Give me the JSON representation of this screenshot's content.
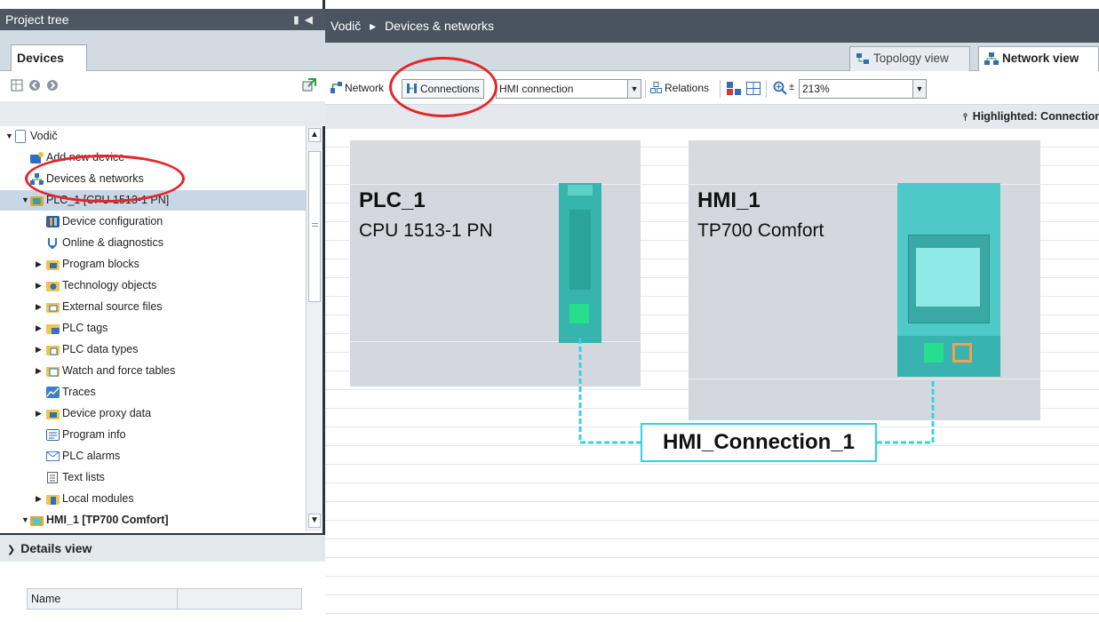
{
  "project_tree": {
    "title": "Project tree",
    "tab": "Devices",
    "items": [
      {
        "label": "Vodič",
        "level": 0,
        "expanded": true,
        "icon": "project-icon"
      },
      {
        "label": "Add new device",
        "level": 1,
        "icon": "add-device-icon"
      },
      {
        "label": "Devices & networks",
        "level": 1,
        "icon": "network-icon"
      },
      {
        "label": "PLC_1 [CPU 1513-1 PN]",
        "level": 1,
        "expanded": true,
        "icon": "plc-icon"
      },
      {
        "label": "Device configuration",
        "level": 2,
        "icon": "device-config-icon"
      },
      {
        "label": "Online & diagnostics",
        "level": 2,
        "icon": "diagnostics-icon"
      },
      {
        "label": "Program blocks",
        "level": 2,
        "collapsed": true,
        "icon": "folder-icon"
      },
      {
        "label": "Technology objects",
        "level": 2,
        "collapsed": true,
        "icon": "folder-icon"
      },
      {
        "label": "External source files",
        "level": 2,
        "collapsed": true,
        "icon": "folder-icon"
      },
      {
        "label": "PLC tags",
        "level": 2,
        "collapsed": true,
        "icon": "folder-icon"
      },
      {
        "label": "PLC data types",
        "level": 2,
        "collapsed": true,
        "icon": "folder-icon"
      },
      {
        "label": "Watch and force tables",
        "level": 2,
        "collapsed": true,
        "icon": "folder-icon"
      },
      {
        "label": "Traces",
        "level": 2,
        "icon": "traces-icon"
      },
      {
        "label": "Device proxy data",
        "level": 2,
        "collapsed": true,
        "icon": "folder-icon"
      },
      {
        "label": "Program info",
        "level": 2,
        "icon": "program-info-icon"
      },
      {
        "label": "PLC alarms",
        "level": 2,
        "icon": "alarms-icon"
      },
      {
        "label": "Text lists",
        "level": 2,
        "icon": "text-lists-icon"
      },
      {
        "label": "Local modules",
        "level": 2,
        "collapsed": true,
        "icon": "folder-icon"
      },
      {
        "label": "HMI_1 [TP700 Comfort]",
        "level": 1,
        "expanded": true,
        "icon": "hmi-icon"
      }
    ]
  },
  "details_view": {
    "title": "Details view",
    "column_name": "Name"
  },
  "breadcrumb": {
    "project": "Vodič",
    "separator": "▸",
    "page": "Devices & networks"
  },
  "view_tabs": {
    "topology": "Topology view",
    "network": "Network view"
  },
  "toolbar": {
    "network": "Network",
    "connections": "Connections",
    "connection_type": "HMI connection",
    "relations": "Relations",
    "zoom": "213%"
  },
  "highlight_bar": {
    "text": "Highlighted: Connection"
  },
  "devices": [
    {
      "name": "PLC_1",
      "type": "CPU 1513-1 PN"
    },
    {
      "name": "HMI_1",
      "type": "TP700 Comfort"
    }
  ],
  "connection": {
    "label": "HMI_Connection_1"
  },
  "colors": {
    "header_dark": "#4a5460",
    "device_bg": "#d5d7de",
    "module_teal": "#35b5ad",
    "status_green": "#25df8c",
    "connection_cyan": "#2fd3e6",
    "annotation_red": "#e3262b"
  }
}
